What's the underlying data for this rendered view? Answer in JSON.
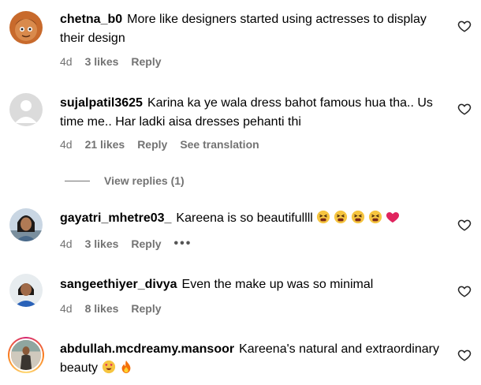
{
  "comments": [
    {
      "username": "chetna_b0",
      "text": "More like designers started using actresses to display their design",
      "time": "4d",
      "likes": "3 likes",
      "reply": "Reply"
    },
    {
      "username": "sujalpatil3625",
      "text": "Karina ka ye wala dress bahot famous hua tha.. Us time me.. Har ladki aisa dresses pehanti thi",
      "time": "4d",
      "likes": "21 likes",
      "reply": "Reply",
      "see_translation": "See translation"
    },
    {
      "username": "gayatri_mhetre03_",
      "text": "Kareena is so beautifullll",
      "time": "4d",
      "likes": "3 likes",
      "reply": "Reply",
      "more": "•••"
    },
    {
      "username": "sangeethiyer_divya",
      "text": "Even the make up was so minimal",
      "time": "4d",
      "likes": "8 likes",
      "reply": "Reply"
    },
    {
      "username": "abdullah.mcdreamy.mansoor",
      "text": "Kareena's natural and extraordinary beauty",
      "time": "",
      "likes": "",
      "reply": ""
    }
  ],
  "view_replies": "View replies (1)",
  "icons": {
    "like": "heart-outline-icon"
  },
  "colors": {
    "muted": "#737373",
    "heart": "#e0245e"
  }
}
